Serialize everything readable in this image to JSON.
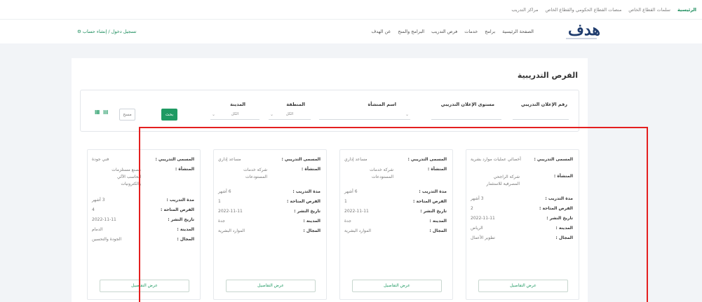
{
  "top_links": [
    "الرئيسية",
    "سلمات القطاع الخاص",
    "منصات القطاع الحكومي والقطاع الخاص",
    "مراكز التدريب"
  ],
  "logo": {
    "text": "هدف"
  },
  "nav": [
    "الصفحة الرئيسية",
    "برامج",
    "خدمات",
    "فرص التدريب",
    "البرامج والمنح",
    "عن الهدف"
  ],
  "login_link": "تسجيل دخول / إنشاء حساب",
  "page_title": "الفرص التدريبية",
  "filters": {
    "labels": {
      "opportunity_no": "رقم الإعلان التدريبي",
      "training_level": "مستوى الإعلان التدريبي",
      "org_name": "اسم المنشأة",
      "region": "المنطقة",
      "city": "المدينة"
    },
    "select_value": "الكل",
    "search_label": "بحث",
    "clear_label": "مسح"
  },
  "card_labels": {
    "title": "المسمى التدريبي :",
    "org": "المنشأة :",
    "duration": "مدة التدريب :",
    "seats": "الفرص المتاحة :",
    "date": "تاريخ النشر :",
    "city": "المدينة :",
    "sector": "المجال :"
  },
  "details_label": "عرض التفاصيل",
  "cards": [
    {
      "title": "أخصائي عمليات موارد بشرية",
      "org": "شركة الراجحي المصرفية للاستثمار",
      "duration": "3 أشهر",
      "seats": "2",
      "date": "2022-11-11",
      "city": "الرياض",
      "sector": "تطوير الأعمال"
    },
    {
      "title": "مساعد إداري",
      "org": "شركة خدمات المستودعات",
      "duration": "6 أشهر",
      "seats": "1",
      "date": "2022-11-11",
      "city": "جدة",
      "sector": "الموارد البشرية"
    },
    {
      "title": "مساعد إداري",
      "org": "شركة خدمات المستودعات",
      "duration": "6 أشهر",
      "seats": "1",
      "date": "2022-11-11",
      "city": "جدة",
      "sector": "الموارد البشرية"
    },
    {
      "title": "فني جودة",
      "org": "مصنع مستلزمات الحاسب الآلي والكترونيات",
      "duration": "3 أشهر",
      "seats": "4",
      "date": "2022-11-11",
      "city": "الدمام",
      "sector": "الجودة والتحسين"
    }
  ]
}
